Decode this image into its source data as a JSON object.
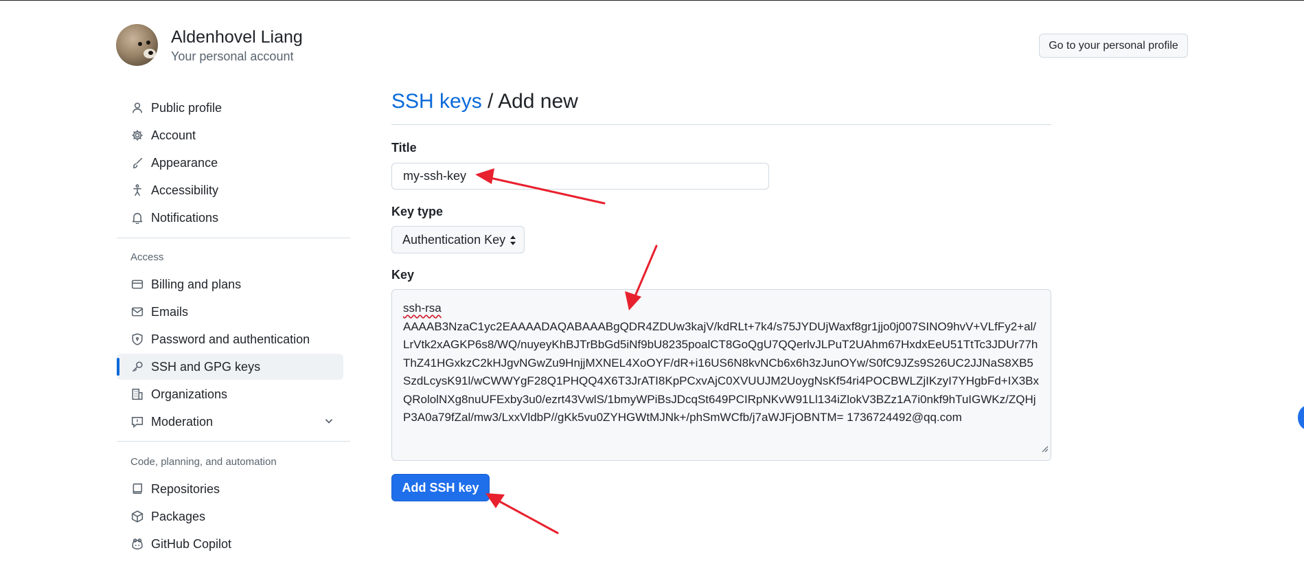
{
  "header": {
    "user_name": "Aldenhovel Liang",
    "user_subtitle": "Your personal account",
    "profile_button": "Go to your personal profile"
  },
  "sidebar": {
    "items": [
      {
        "label": "Public profile",
        "icon": "person-icon"
      },
      {
        "label": "Account",
        "icon": "gear-icon"
      },
      {
        "label": "Appearance",
        "icon": "paintbrush-icon"
      },
      {
        "label": "Accessibility",
        "icon": "accessibility-icon"
      },
      {
        "label": "Notifications",
        "icon": "bell-icon"
      }
    ],
    "access_heading": "Access",
    "access_items": [
      {
        "label": "Billing and plans",
        "icon": "credit-card-icon"
      },
      {
        "label": "Emails",
        "icon": "mail-icon"
      },
      {
        "label": "Password and authentication",
        "icon": "shield-lock-icon"
      },
      {
        "label": "SSH and GPG keys",
        "icon": "key-icon",
        "active": true
      },
      {
        "label": "Organizations",
        "icon": "organization-icon"
      },
      {
        "label": "Moderation",
        "icon": "report-icon"
      }
    ],
    "code_heading": "Code, planning, and automation",
    "code_items": [
      {
        "label": "Repositories",
        "icon": "repo-icon"
      },
      {
        "label": "Packages",
        "icon": "package-icon"
      },
      {
        "label": "GitHub Copilot",
        "icon": "copilot-icon"
      }
    ]
  },
  "main": {
    "breadcrumb_link": "SSH keys",
    "breadcrumb_sep": " / ",
    "breadcrumb_current": "Add new",
    "title_label": "Title",
    "title_value": "my-ssh-key",
    "key_type_label": "Key type",
    "key_type_value": "Authentication Key",
    "key_label": "Key",
    "key_first_line": "ssh-rsa",
    "key_value": "AAAAB3NzaC1yc2EAAAADAQABAAABgQDR4ZDUw3kajV/kdRLt+7k4/s75JYDUjWaxf8gr1jjo0j007SINO9hvV+VLfFy2+al/LrVtk2xAGKP6s8/WQ/nuyeyKhBJTrBbGd5iNf9bU8235poalCT8GoQgU7QQerlvJLPuT2UAhm67HxdxEeU51TtTc3JDUr77hThZ41HGxkzC2kHJgvNGwZu9HnjjMXNEL4XoOYF/dR+i16US6N8kvNCb6x6h3zJunOYw/S0fC9JZs9S26UC2JJNaS8XB5SzdLcysK91l/wCWWYgF28Q1PHQQ4X6T3JrATI8KpPCxvAjC0XVUUJM2UoygNsKf54ri4POCBWLZjIKzyI7YHgbFd+IX3BxQRololNXg8nuUFExby3u0/ezrt43VwlS/1bmyWPiBsJDcqSt649PCIRpNKvW91Ll134iZlokV3BZz1A7i0nkf9hTuIGWKz/ZQHjP3A0a79fZal/mw3/LxxVldbP//gKk5vu0ZYHGWtMJNk+/phSmWCfb/j7aWJFjOBNTM= 1736724492@qq.com",
    "submit_button": "Add SSH key"
  },
  "colors": {
    "accent_blue": "#0969da",
    "button_blue": "#1f6feb",
    "annotation_red": "#e8212e"
  }
}
